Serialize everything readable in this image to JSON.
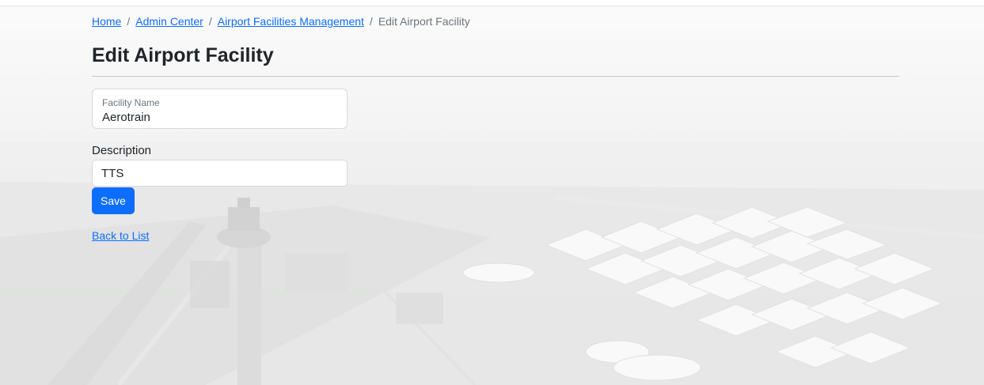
{
  "breadcrumb": {
    "home": "Home",
    "admin_center": "Admin Center",
    "facilities_management": "Airport Facilities Management",
    "current": "Edit Airport Facility",
    "separator": "/"
  },
  "page": {
    "title": "Edit Airport Facility"
  },
  "form": {
    "facility_name": {
      "label": "Facility Name",
      "value": "Aerotrain"
    },
    "description": {
      "label": "Description",
      "value": "TTS"
    },
    "save_label": "Save"
  },
  "links": {
    "back_to_list": "Back to List"
  },
  "colors": {
    "primary": "#0d6efd",
    "breadcrumb_current": "#6c757d"
  }
}
